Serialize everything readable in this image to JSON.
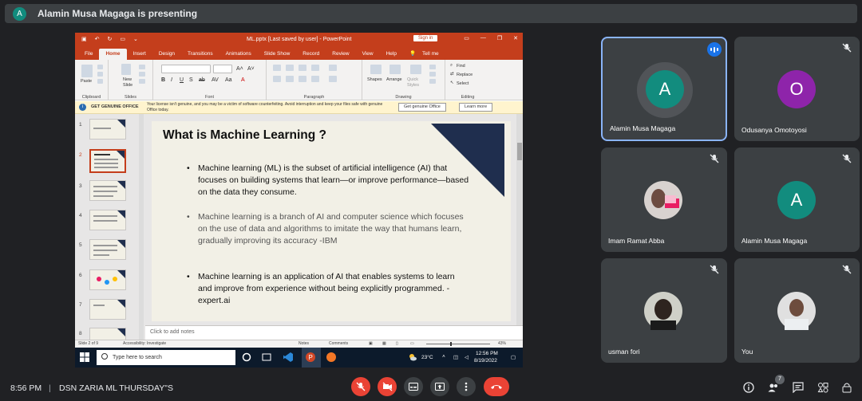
{
  "presenter_bar": {
    "avatar_letter": "A",
    "text": "Alamin Musa Magaga is presenting"
  },
  "powerpoint": {
    "window_title": "ML.pptx [Last saved by user] - PowerPoint",
    "sign_in": "Sign in",
    "tabs": [
      "File",
      "Home",
      "Insert",
      "Design",
      "Transitions",
      "Animations",
      "Slide Show",
      "Record",
      "Review",
      "View",
      "Help",
      "Tell me"
    ],
    "active_tab": "Home",
    "ribbon": {
      "groups": [
        "Clipboard",
        "Slides",
        "Font",
        "Paragraph",
        "Drawing",
        "Editing"
      ],
      "paste": "Paste",
      "new_slide": "New Slide",
      "shapes": "Shapes",
      "arrange": "Arrange",
      "quick_styles": "Quick Styles",
      "find": "Find",
      "replace": "Replace",
      "select": "Select"
    },
    "warning": {
      "heading": "GET GENUINE OFFICE",
      "message": "Your license isn't genuine, and you may be a victim of software counterfeiting. Avoid interruption and keep your files safe with genuine Office today.",
      "button_primary": "Get genuine Office",
      "button_secondary": "Learn more"
    },
    "thumbnails": [
      "1",
      "2",
      "3",
      "4",
      "5",
      "6",
      "7",
      "8"
    ],
    "selected_slide": 2,
    "slide": {
      "title": "What is Machine Learning ?",
      "bullets": [
        "Machine learning (ML) is the subset of artificial intelligence (AI) that focuses on building systems that learn—or improve performance—based on the data they consume.",
        "Machine learning is a branch of AI and computer science which focuses on the use of data and algorithms to imitate the way that humans learn, gradually improving its accuracy  -IBM",
        "Machine learning is an application of AI that enables systems to learn and improve from experience without being explicitly programmed.  -expert.ai"
      ]
    },
    "notes_placeholder": "Click to add notes",
    "status": {
      "slide_count": "Slide 2 of 9",
      "accessibility": "Accessibility: Investigate",
      "notes": "Notes",
      "comments": "Comments",
      "zoom": "43%"
    },
    "taskbar": {
      "search_placeholder": "Type here to search",
      "weather": "23°C",
      "clock_time": "12:56 PM",
      "clock_date": "8/19/2022"
    }
  },
  "participants": [
    {
      "name": "Alamin Musa Magaga",
      "letter": "A",
      "color": "#128c7e",
      "speaking": true
    },
    {
      "name": "Odusanya Omotoyosi",
      "letter": "O",
      "color": "#8e24aa",
      "muted": true
    },
    {
      "name": "Imam Ramat Abba",
      "photo": true,
      "muted": true
    },
    {
      "name": "Alamin Musa Magaga",
      "letter": "A",
      "color": "#128c7e",
      "muted": true
    },
    {
      "name": "usman fori",
      "photo": true,
      "muted": true
    },
    {
      "name": "You",
      "photo": true,
      "muted": true
    }
  ],
  "bottom_bar": {
    "time": "8:56 PM",
    "separator": "|",
    "meeting_name": "DSN ZARIA ML THURSDAY\"S",
    "people_count": "7"
  },
  "colors": {
    "end_call": "#ea4335",
    "accent": "#8ab4f8",
    "ppt_brand": "#c43e1c"
  }
}
